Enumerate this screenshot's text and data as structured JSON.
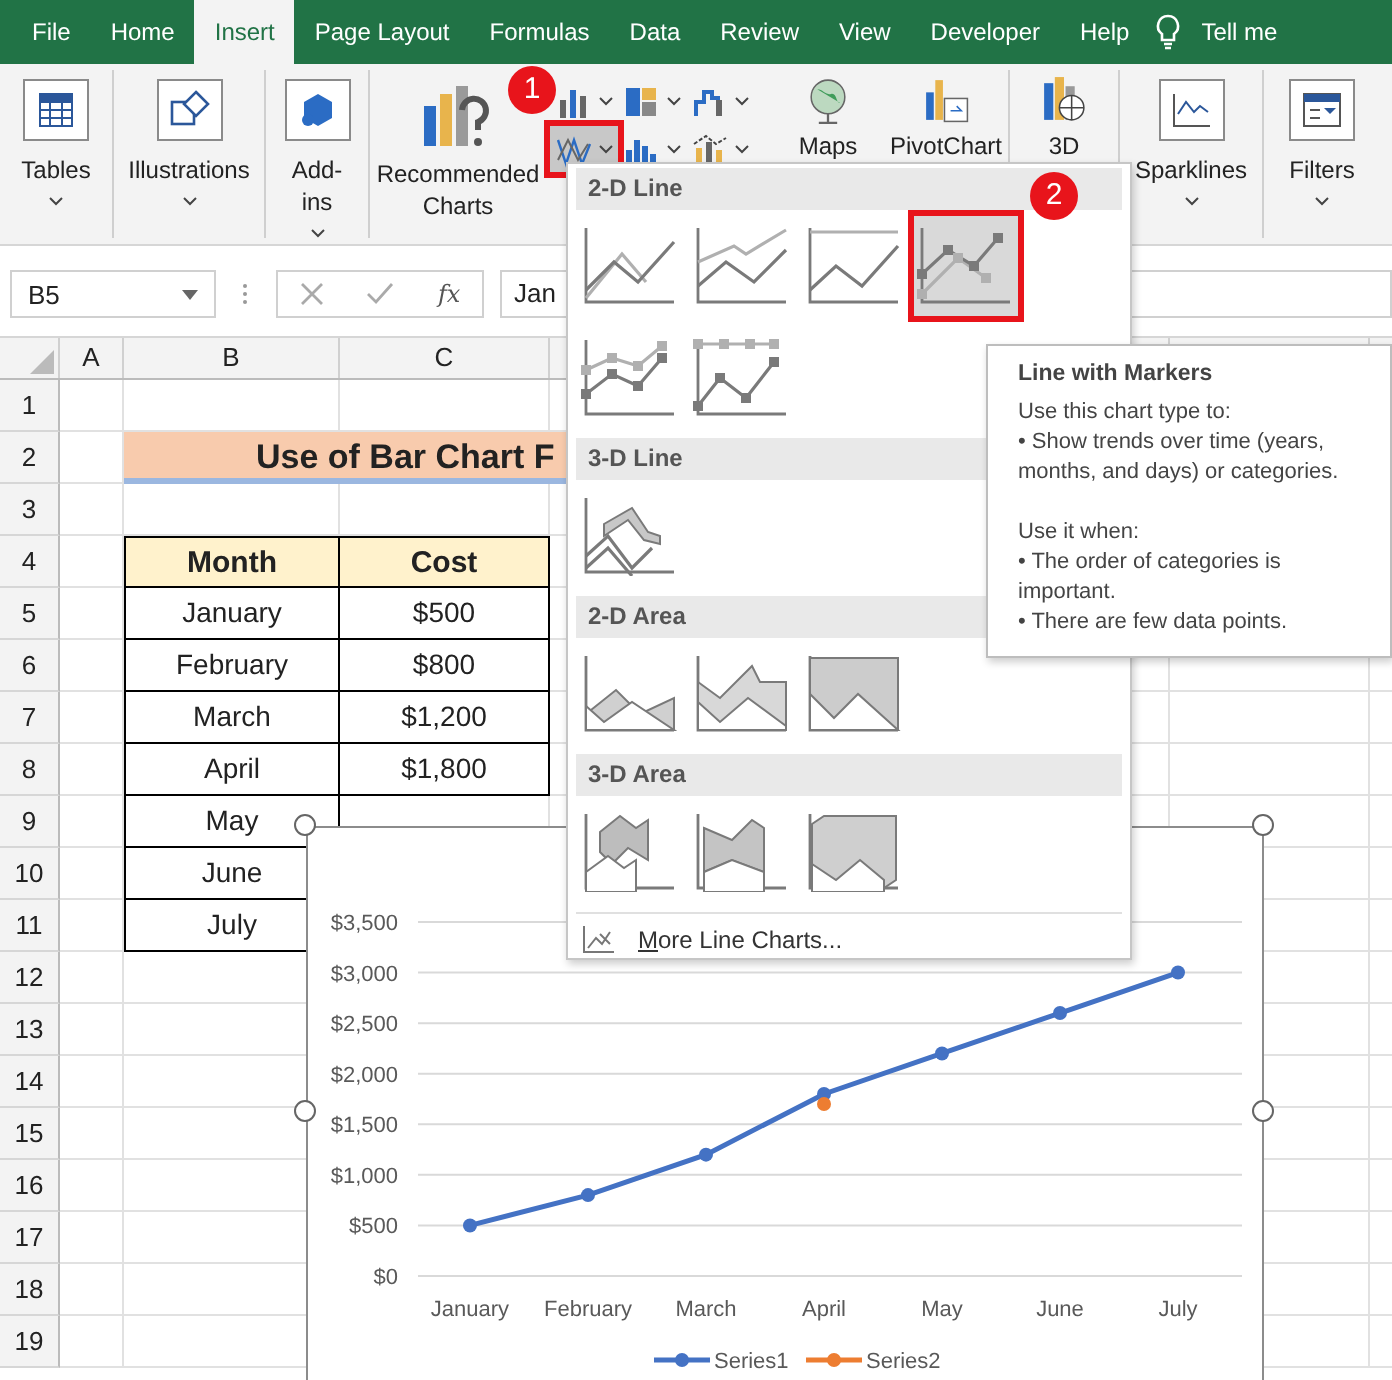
{
  "ribbon": {
    "tabs": [
      {
        "label": "File",
        "selected": false
      },
      {
        "label": "Home",
        "selected": false
      },
      {
        "label": "Insert",
        "selected": true
      },
      {
        "label": "Page Layout",
        "selected": false
      },
      {
        "label": "Formulas",
        "selected": false
      },
      {
        "label": "Data",
        "selected": false
      },
      {
        "label": "Review",
        "selected": false
      },
      {
        "label": "View",
        "selected": false
      },
      {
        "label": "Developer",
        "selected": false
      },
      {
        "label": "Help",
        "selected": false
      },
      {
        "label": "Tell me",
        "selected": false
      }
    ],
    "left_buttons": [
      {
        "kind": "tables",
        "lines": [
          "Tables"
        ]
      },
      {
        "kind": "illustrations",
        "lines": [
          "Illustrations"
        ]
      },
      {
        "kind": "addins",
        "lines": [
          "Add-",
          "ins"
        ]
      }
    ],
    "charts": {
      "recommended": {
        "lines": [
          "Recommended",
          "Charts"
        ]
      },
      "chart_types": [
        {
          "kind": "column",
          "selected": false
        },
        {
          "kind": "hierarchy",
          "selected": false
        },
        {
          "kind": "waterfall",
          "selected": false
        },
        {
          "kind": "line",
          "selected": true
        },
        {
          "kind": "statistic",
          "selected": false
        },
        {
          "kind": "combo",
          "selected": false
        }
      ],
      "maps": {
        "lines": [
          "Maps"
        ]
      },
      "pivot": {
        "lines": [
          "PivotChart"
        ]
      }
    },
    "right_buttons": [
      {
        "kind": "map3d",
        "lines": [
          "3D"
        ]
      },
      {
        "kind": "sparklines",
        "lines": [
          "Sparklines"
        ]
      },
      {
        "kind": "filters",
        "lines": [
          "Filters"
        ]
      }
    ]
  },
  "callouts": [
    {
      "label": "1"
    },
    {
      "label": "2"
    }
  ],
  "formula_bar": {
    "name_box": "B5",
    "function_label": "fx",
    "content": "Jan"
  },
  "sheet": {
    "columns": [
      "A",
      "B",
      "C"
    ],
    "rows": [
      "1",
      "2",
      "3",
      "4",
      "5",
      "6",
      "7",
      "8",
      "9",
      "10",
      "11",
      "12",
      "13",
      "14",
      "15",
      "16",
      "17",
      "18",
      "19"
    ],
    "title": "Use of Bar Chart F",
    "table": {
      "columns": [
        "Month",
        "Cost"
      ],
      "rows": [
        [
          "January",
          "$500"
        ],
        [
          "February",
          "$800"
        ],
        [
          "March",
          "$1,200"
        ],
        [
          "April",
          "$1,800"
        ],
        [
          "May"
        ],
        [
          "June"
        ],
        [
          "July"
        ]
      ]
    }
  },
  "line_menu": {
    "sections": [
      {
        "title": "2-D Line",
        "items": [
          {
            "kind": "line",
            "selected": false
          },
          {
            "kind": "stacked-line",
            "selected": false
          },
          {
            "kind": "percent-line",
            "selected": false
          },
          {
            "kind": "line-markers",
            "selected": true
          },
          {
            "kind": "stacked-line-markers",
            "selected": false
          },
          {
            "kind": "percent-line-markers",
            "selected": false
          }
        ]
      },
      {
        "title": "3-D Line",
        "items": [
          {
            "kind": "line-3d",
            "selected": false
          }
        ]
      },
      {
        "title": "2-D Area",
        "items": [
          {
            "kind": "area",
            "selected": false
          },
          {
            "kind": "stacked-area",
            "selected": false
          },
          {
            "kind": "percent-area",
            "selected": false
          }
        ]
      },
      {
        "title": "3-D Area",
        "items": [
          {
            "kind": "area-3d",
            "selected": false
          },
          {
            "kind": "stacked-area-3d",
            "selected": false
          },
          {
            "kind": "percent-area-3d",
            "selected": false
          }
        ]
      }
    ],
    "more": "More Line Charts..."
  },
  "tooltip": {
    "title": "Line with Markers",
    "paragraphs": [
      "Use this chart type to:",
      "• Show trends over time (years, months, and days) or categories.",
      "Use it when:",
      "• The order of categories is important.",
      "• There are few data points."
    ]
  },
  "chart": {
    "chart_data": {
      "type": "line",
      "categories": [
        "January",
        "February",
        "March",
        "April",
        "May",
        "June",
        "July"
      ],
      "series": [
        {
          "name": "Series1",
          "color": "#4472c4",
          "marker": "circle",
          "values": [
            500,
            800,
            1200,
            1800,
            2200,
            2600,
            3000
          ]
        },
        {
          "name": "Series2",
          "color": "#ed7d31",
          "marker": "circle",
          "values": [
            null,
            null,
            null,
            1700,
            null,
            null,
            null
          ]
        }
      ],
      "grid": true,
      "legend": true,
      "ylim": [
        0,
        3500
      ],
      "yticks": [
        {
          "value": 0,
          "label": "$0"
        },
        {
          "value": 500,
          "label": "$500"
        },
        {
          "value": 1000,
          "label": "$1,000"
        },
        {
          "value": 1500,
          "label": "$1,500"
        },
        {
          "value": 2000,
          "label": "$2,000"
        },
        {
          "value": 2500,
          "label": "$2,500"
        },
        {
          "value": 3000,
          "label": "$3,000"
        },
        {
          "value": 3500,
          "label": "$3,500"
        }
      ]
    }
  }
}
